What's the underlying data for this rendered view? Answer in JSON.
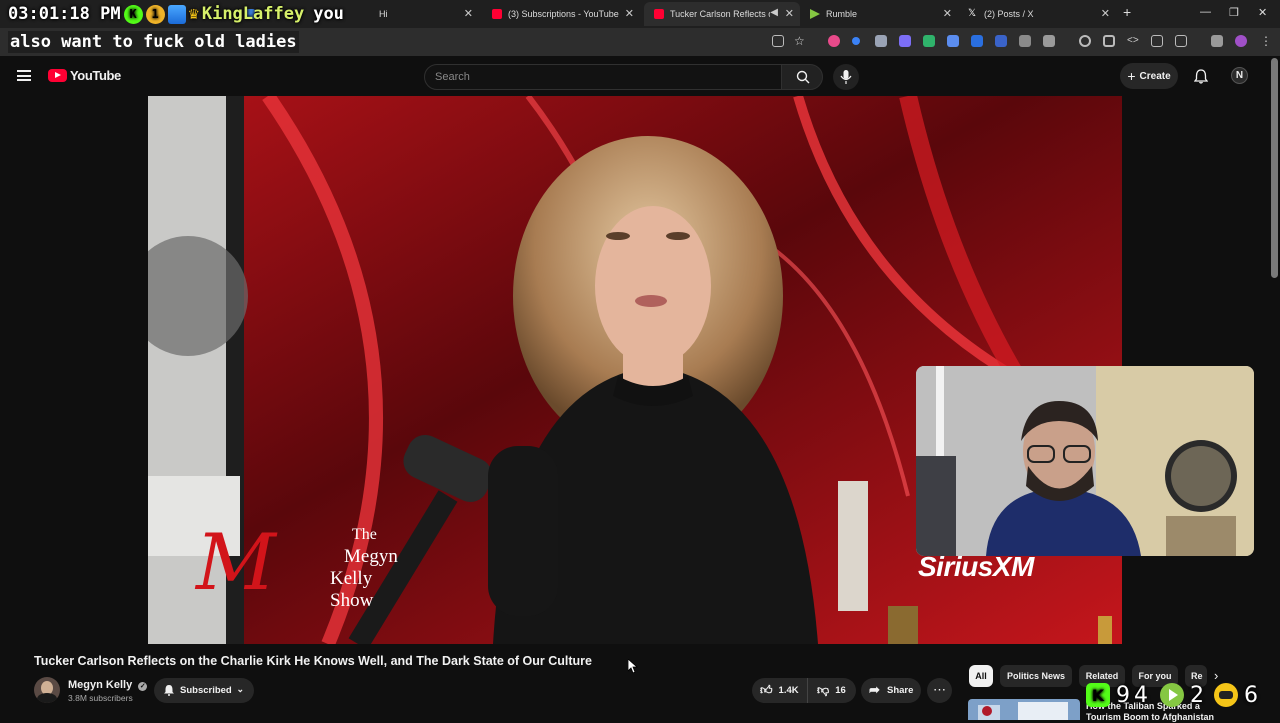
{
  "browser": {
    "tabs": [
      {
        "label": "Hi",
        "active": false,
        "favicon_color": "#3c7dd9"
      },
      {
        "label": "(3) Subscriptions - YouTube",
        "active": false,
        "favicon_color": "#ff0033"
      },
      {
        "label": "Tucker Carlson Reflects on t",
        "active": true,
        "favicon_color": "#ff0033"
      },
      {
        "label": "Rumble",
        "active": false,
        "favicon_color": "#85c742"
      },
      {
        "label": "(2) Posts / X",
        "active": false,
        "favicon_color": "#ffffff"
      }
    ]
  },
  "overlay": {
    "clock": "03:01:18 PM",
    "badge_1_icon": "kick-icon",
    "badge_2_number": "1",
    "username": "KingLaffey",
    "message_start": "you",
    "message_rest": "also want to fuck old ladies"
  },
  "youtube": {
    "logo_text": "YouTube",
    "search_placeholder": "Search",
    "create_label": "Create",
    "account_initial": "N"
  },
  "video": {
    "show_logo_line1": "The",
    "show_logo_line2": "Megyn",
    "show_logo_line3": "Kelly",
    "show_logo_line4": "Show",
    "sponsor_logo": "SiriusXM"
  },
  "info": {
    "title": "Tucker Carlson Reflects on the Charlie Kirk He Knows Well, and The Dark State of Our Culture",
    "channel": "Megyn Kelly",
    "subscribers": "3.8M subscribers",
    "subscribe_label": "Subscribed",
    "likes": "1.4K",
    "dislikes": "16",
    "share_label": "Share"
  },
  "chips": [
    "All",
    "Politics News",
    "Related",
    "For you",
    "Re"
  ],
  "recommendation": {
    "title": "How the Taliban Sparked a Tourism Boom to Afghanistan"
  },
  "stream_counters": {
    "kick_count": "94",
    "rumble_count": "2",
    "other_count": "6"
  },
  "colors": {
    "yt_red": "#ff0033",
    "kick_green": "#53fc18",
    "rumble_green": "#85c742"
  }
}
